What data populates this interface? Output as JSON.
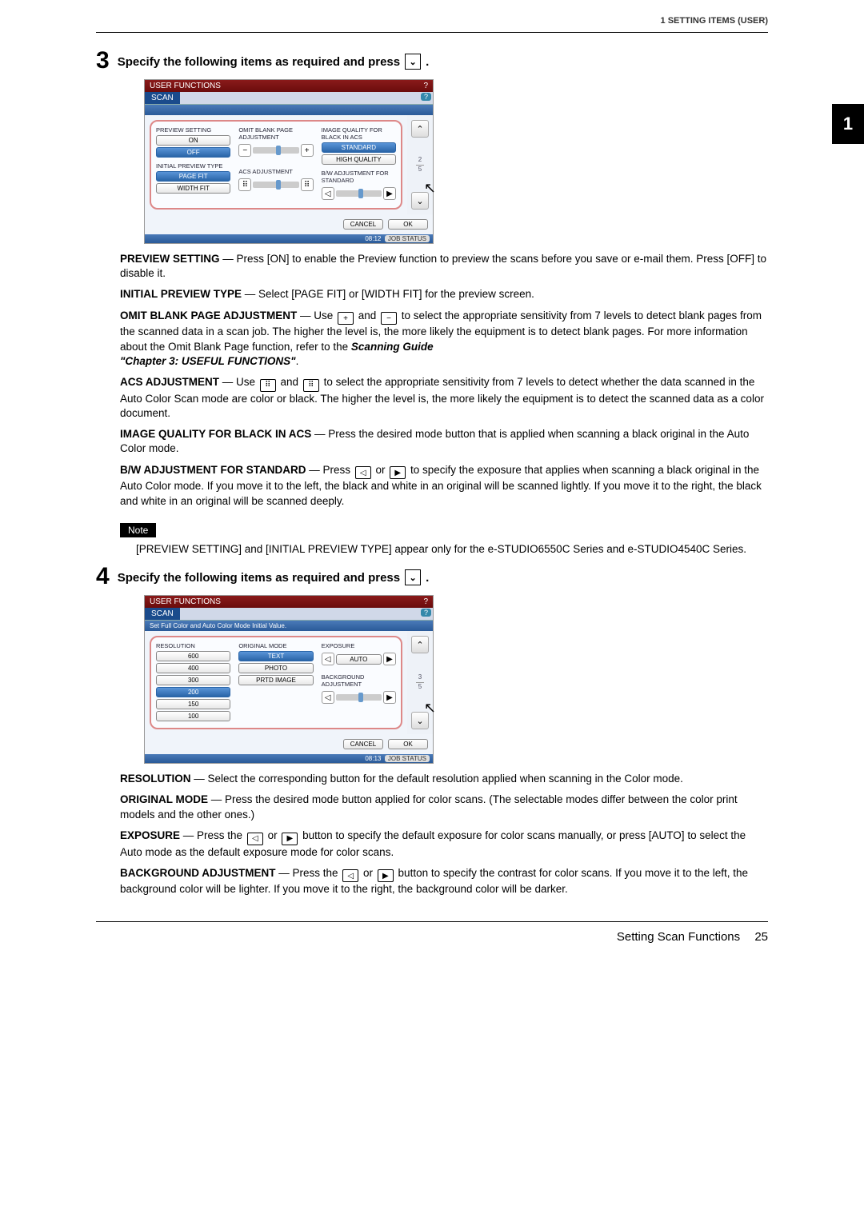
{
  "header": {
    "section": "1 SETTING ITEMS (USER)",
    "chapter_tab": "1"
  },
  "steps": {
    "s3": {
      "num": "3",
      "title": "Specify the following items as required and press",
      "end": "."
    },
    "s4": {
      "num": "4",
      "title": "Specify the following items as required and press",
      "end": "."
    }
  },
  "screenshot1": {
    "titlebar": "USER FUNCTIONS",
    "help": "?",
    "tab": "SCAN",
    "col1": {
      "preview_label": "PREVIEW\nSETTING",
      "on": "ON",
      "off": "OFF",
      "initial_label": "INITIAL\nPREVIEW TYPE",
      "pagefit": "PAGE FIT",
      "widthfit": "WIDTH FIT"
    },
    "col2": {
      "omit_label": "OMIT BLANK PAGE\nADJUSTMENT",
      "acs_label": "ACS ADJUSTMENT"
    },
    "col3": {
      "iq_label": "IMAGE QUALITY FOR\nBLACK IN ACS",
      "standard": "STANDARD",
      "highq": "HIGH QUALITY",
      "bw_label": "B/W ADJUSTMENT FOR\nSTANDARD"
    },
    "page_ind": {
      "cur": "2",
      "total": "5"
    },
    "cancel": "CANCEL",
    "ok": "OK",
    "time": "08:12",
    "jobstatus": "JOB STATUS"
  },
  "desc3": {
    "preview": {
      "label": "PREVIEW SETTING",
      "text": " — Press [ON] to enable the Preview function to preview the scans before you save or e-mail them. Press [OFF] to disable it."
    },
    "initial": {
      "label": "INITIAL PREVIEW TYPE",
      "text": " — Select [PAGE FIT] or [WIDTH FIT] for the preview screen."
    },
    "omit": {
      "label": "OMIT BLANK PAGE ADJUSTMENT",
      "pre": " — Use ",
      "mid": " and ",
      "post": " to select the appropriate sensitivity from 7 levels to detect blank pages from the scanned data in a scan job. The higher the level is, the more likely the equipment is to detect blank pages. For more information about the Omit Blank Page function, refer to the ",
      "ref1": "Scanning Guide",
      "ref2": "\"Chapter 3: USEFUL FUNCTIONS\"",
      "end": "."
    },
    "acs": {
      "label": "ACS ADJUSTMENT",
      "pre": " — Use ",
      "mid": " and ",
      "post": " to select the appropriate sensitivity from 7 levels to detect whether the data scanned in the Auto Color Scan mode are color or black. The higher the level is, the more likely the equipment is to detect the scanned data as a color document."
    },
    "iq": {
      "label": "IMAGE QUALITY FOR BLACK IN ACS",
      "text": " — Press the desired mode button that is applied when scanning a black original in the Auto Color mode."
    },
    "bw": {
      "label": "B/W ADJUSTMENT FOR STANDARD",
      "pre": " — Press ",
      "mid": " or ",
      "post": " to specify the exposure that applies when scanning a black original in the Auto Color mode. If you move it to the left, the black and white in an original will be scanned lightly. If you move it to the right, the black and white in an original will be scanned deeply."
    }
  },
  "note": {
    "label": "Note",
    "text": "[PREVIEW SETTING] and [INITIAL PREVIEW TYPE] appear only for the e-STUDIO6550C Series and e-STUDIO4540C Series."
  },
  "screenshot2": {
    "titlebar": "USER FUNCTIONS",
    "help": "?",
    "tab": "SCAN",
    "subbar": "Set Full Color and Auto Color Mode Initial Value.",
    "col1": {
      "resolution": "RESOLUTION",
      "r600": "600",
      "r400": "400",
      "r300": "300",
      "r200": "200",
      "r150": "150",
      "r100": "100"
    },
    "col2": {
      "orig_label": "ORIGINAL MODE",
      "text": "TEXT",
      "photo": "PHOTO",
      "prtd": "PRTD IMAGE"
    },
    "col3": {
      "exposure": "EXPOSURE",
      "auto": "AUTO",
      "background": "BACKGROUND\nADJUSTMENT"
    },
    "page_ind": {
      "cur": "3",
      "total": "5"
    },
    "cancel": "CANCEL",
    "ok": "OK",
    "time": "08:13",
    "jobstatus": "JOB STATUS"
  },
  "desc4": {
    "resolution": {
      "label": "RESOLUTION",
      "text": " — Select the corresponding button for the default resolution applied when scanning in the Color mode."
    },
    "orig": {
      "label": "ORIGINAL MODE",
      "text": " — Press the desired mode button applied for color scans. (The selectable modes differ between the color print models and the other ones.)"
    },
    "exposure": {
      "label": "EXPOSURE",
      "pre": " — Press the ",
      "mid": " or ",
      "post": " button to specify the default exposure for color scans manually, or press [AUTO] to select the Auto mode as the default exposure mode for color scans."
    },
    "bg": {
      "label": "BACKGROUND ADJUSTMENT",
      "pre": " — Press the ",
      "mid": " or ",
      "post": " button to specify the contrast for color scans. If you move it to the left, the background color will be lighter. If you move it to the right, the background color will be darker."
    }
  },
  "footer": {
    "title": "Setting Scan Functions",
    "page": "25"
  }
}
